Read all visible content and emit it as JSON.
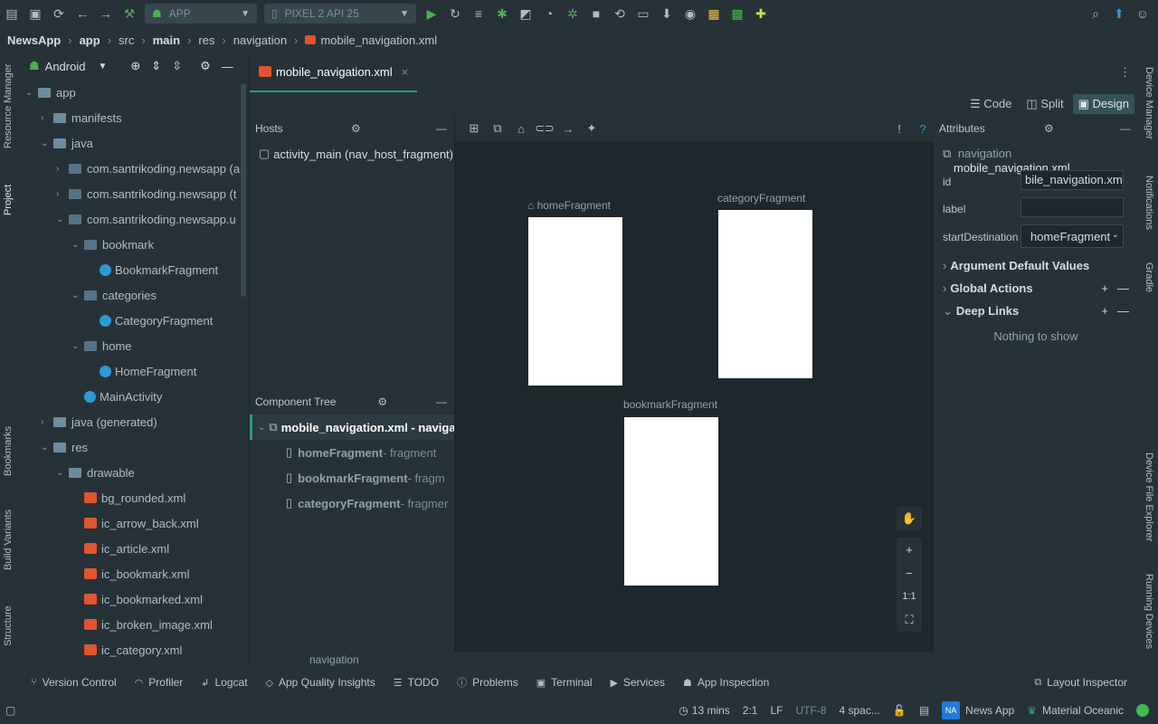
{
  "toolbar": {
    "run_config": "APP",
    "device": "PIXEL 2 API 25"
  },
  "breadcrumb": [
    "NewsApp",
    "app",
    "src",
    "main",
    "res",
    "navigation",
    "mobile_navigation.xml"
  ],
  "project_panel": {
    "view_mode": "Android",
    "tree": [
      {
        "label": "app",
        "indent": 0,
        "arrow": "down",
        "icon": "folder"
      },
      {
        "label": "manifests",
        "indent": 1,
        "arrow": "right",
        "icon": "folder"
      },
      {
        "label": "java",
        "indent": 1,
        "arrow": "down",
        "icon": "folder"
      },
      {
        "label": "com.santrikoding.newsapp (a",
        "indent": 2,
        "arrow": "right",
        "icon": "package"
      },
      {
        "label": "com.santrikoding.newsapp (t",
        "indent": 2,
        "arrow": "right",
        "icon": "package"
      },
      {
        "label": "com.santrikoding.newsapp.u",
        "indent": 2,
        "arrow": "down",
        "icon": "package"
      },
      {
        "label": "bookmark",
        "indent": 3,
        "arrow": "down",
        "icon": "package"
      },
      {
        "label": "BookmarkFragment",
        "indent": 4,
        "arrow": "",
        "icon": "kotlin"
      },
      {
        "label": "categories",
        "indent": 3,
        "arrow": "down",
        "icon": "package"
      },
      {
        "label": "CategoryFragment",
        "indent": 4,
        "arrow": "",
        "icon": "kotlin"
      },
      {
        "label": "home",
        "indent": 3,
        "arrow": "down",
        "icon": "package"
      },
      {
        "label": "HomeFragment",
        "indent": 4,
        "arrow": "",
        "icon": "kotlin"
      },
      {
        "label": "MainActivity",
        "indent": 3,
        "arrow": "",
        "icon": "kotlin"
      },
      {
        "label": "java (generated)",
        "indent": 1,
        "arrow": "right",
        "icon": "folder"
      },
      {
        "label": "res",
        "indent": 1,
        "arrow": "down",
        "icon": "folder"
      },
      {
        "label": "drawable",
        "indent": 2,
        "arrow": "down",
        "icon": "folder"
      },
      {
        "label": "bg_rounded.xml",
        "indent": 3,
        "arrow": "",
        "icon": "xml"
      },
      {
        "label": "ic_arrow_back.xml",
        "indent": 3,
        "arrow": "",
        "icon": "xml"
      },
      {
        "label": "ic_article.xml",
        "indent": 3,
        "arrow": "",
        "icon": "xml"
      },
      {
        "label": "ic_bookmark.xml",
        "indent": 3,
        "arrow": "",
        "icon": "xml"
      },
      {
        "label": "ic_bookmarked.xml",
        "indent": 3,
        "arrow": "",
        "icon": "xml"
      },
      {
        "label": "ic_broken_image.xml",
        "indent": 3,
        "arrow": "",
        "icon": "xml"
      },
      {
        "label": "ic_category.xml",
        "indent": 3,
        "arrow": "",
        "icon": "xml"
      }
    ]
  },
  "left_strip_tabs": [
    "Resource Manager",
    "Project",
    "Bookmarks",
    "Build Variants",
    "Structure"
  ],
  "right_strip_tabs": [
    "Device Manager",
    "Notifications",
    "Gradle",
    "Device File Explorer",
    "Running Devices"
  ],
  "editor": {
    "tab_label": "mobile_navigation.xml",
    "modes": [
      "Code",
      "Split",
      "Design"
    ],
    "active_mode": "Design"
  },
  "hosts": {
    "title": "Hosts",
    "items": [
      "activity_main (nav_host_fragment)"
    ]
  },
  "component_tree": {
    "title": "Component Tree",
    "root": "mobile_navigation.xml - naviga",
    "children": [
      {
        "name": "homeFragment",
        "type": " - fragment"
      },
      {
        "name": "bookmarkFragment",
        "type": " - fragm"
      },
      {
        "name": "categoryFragment",
        "type": " - fragmer"
      }
    ]
  },
  "canvas": {
    "fragments": [
      {
        "label": "homeFragment",
        "start": true
      },
      {
        "label": "categoryFragment",
        "start": false
      },
      {
        "label": "bookmarkFragment",
        "start": false
      }
    ],
    "zoom_controls": [
      "+",
      "−",
      "1:1"
    ]
  },
  "attributes": {
    "title": "Attributes",
    "type": "navigation",
    "file": "mobile_navigation.xml",
    "id_label": "id",
    "id_value": "bile_navigation.xml",
    "label_label": "label",
    "label_value": "",
    "start_label": "startDestination",
    "start_value": "homeFragment",
    "sections": [
      "Argument Default Values",
      "Global Actions",
      "Deep Links"
    ],
    "deep_links_empty": "Nothing to show"
  },
  "path_bar": "navigation",
  "bottom_tools": [
    "Version Control",
    "Profiler",
    "Logcat",
    "App Quality Insights",
    "TODO",
    "Problems",
    "Terminal",
    "Services",
    "App Inspection",
    "Layout Inspector"
  ],
  "status": {
    "time": "13 mins",
    "position": "2:1",
    "line_sep": "LF",
    "encoding": "UTF-8",
    "indent": "4 spac...",
    "project_badge": "NA",
    "project": "News App",
    "theme": "Material Oceanic"
  }
}
